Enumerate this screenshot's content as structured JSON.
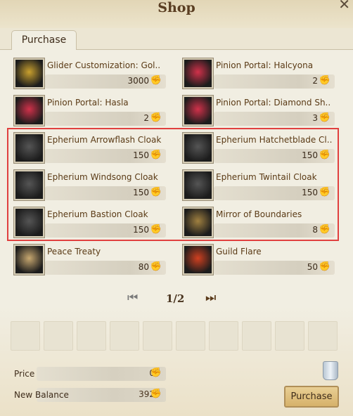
{
  "window": {
    "title": "Shop",
    "close": "✕"
  },
  "tabs": [
    {
      "label": "Purchase"
    }
  ],
  "items": [
    {
      "name": "Glider Customization: Gol..",
      "price": "3000",
      "icon": "glider-gold-icon",
      "color": "#c9a02e"
    },
    {
      "name": "Pinion Portal: Halcyona",
      "price": "2",
      "icon": "pinion-feather-icon",
      "color": "#d0314a"
    },
    {
      "name": "Pinion Portal: Hasla",
      "price": "2",
      "icon": "pinion-feather-icon",
      "color": "#d0314a"
    },
    {
      "name": "Pinion Portal: Diamond Sh..",
      "price": "3",
      "icon": "pinion-feather-icon",
      "color": "#d0314a"
    },
    {
      "name": "Epherium Arrowflash Cloak",
      "price": "150",
      "icon": "cloak-icon",
      "color": "#555"
    },
    {
      "name": "Epherium Hatchetblade Cl..",
      "price": "150",
      "icon": "cloak-icon",
      "color": "#555"
    },
    {
      "name": "Epherium Windsong Cloak",
      "price": "150",
      "icon": "cloak-icon",
      "color": "#555"
    },
    {
      "name": "Epherium Twintail Cloak",
      "price": "150",
      "icon": "cloak-icon",
      "color": "#555"
    },
    {
      "name": "Epherium Bastion Cloak",
      "price": "150",
      "icon": "cloak-icon",
      "color": "#555"
    },
    {
      "name": "Mirror of Boundaries",
      "price": "8",
      "icon": "mirror-icon",
      "color": "#a08040"
    },
    {
      "name": "Peace Treaty",
      "price": "80",
      "icon": "scroll-icon",
      "color": "#c8a870"
    },
    {
      "name": "Guild Flare",
      "price": "50",
      "icon": "flare-icon",
      "color": "#d04020"
    }
  ],
  "pager": {
    "text": "1/2"
  },
  "summary": {
    "price_label": "Price",
    "price_value": "0",
    "balance_label": "New Balance",
    "balance_value": "392"
  },
  "buttons": {
    "purchase": "Purchase"
  }
}
